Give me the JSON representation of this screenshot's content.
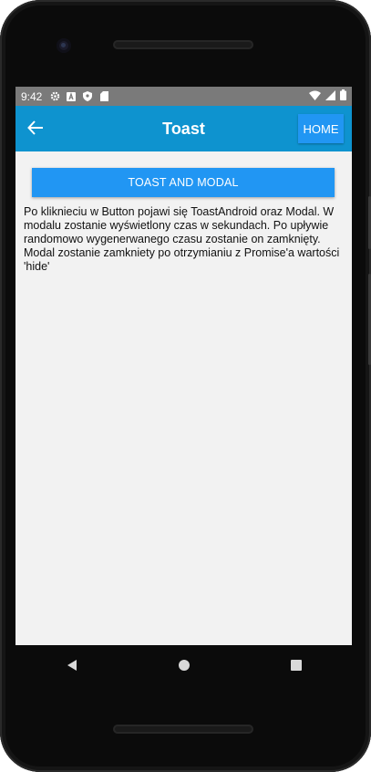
{
  "status_bar": {
    "time": "9:42",
    "left_icons": [
      "gear-icon",
      "a-badge-icon",
      "shield-icon",
      "sd-card-icon"
    ],
    "right_icons": [
      "wifi-icon",
      "signal-icon",
      "battery-icon"
    ]
  },
  "app_bar": {
    "title": "Toast",
    "home_label": "HOME"
  },
  "content": {
    "button_label": "TOAST AND MODAL",
    "description": "Po kliknieciu w Button pojawi się ToastAndroid oraz Modal. W modalu zostanie wyświetlony czas w sekundach. Po upływie randomowo wygenerwanego czasu zostanie on zamknięty. Modal zostanie zamkniety po otrzymianiu z Promise'a wartości 'hide'"
  },
  "colors": {
    "app_bar": "#0e93cf",
    "button": "#2196f3",
    "status_bar": "#7a7a7a",
    "background": "#f2f2f2"
  }
}
